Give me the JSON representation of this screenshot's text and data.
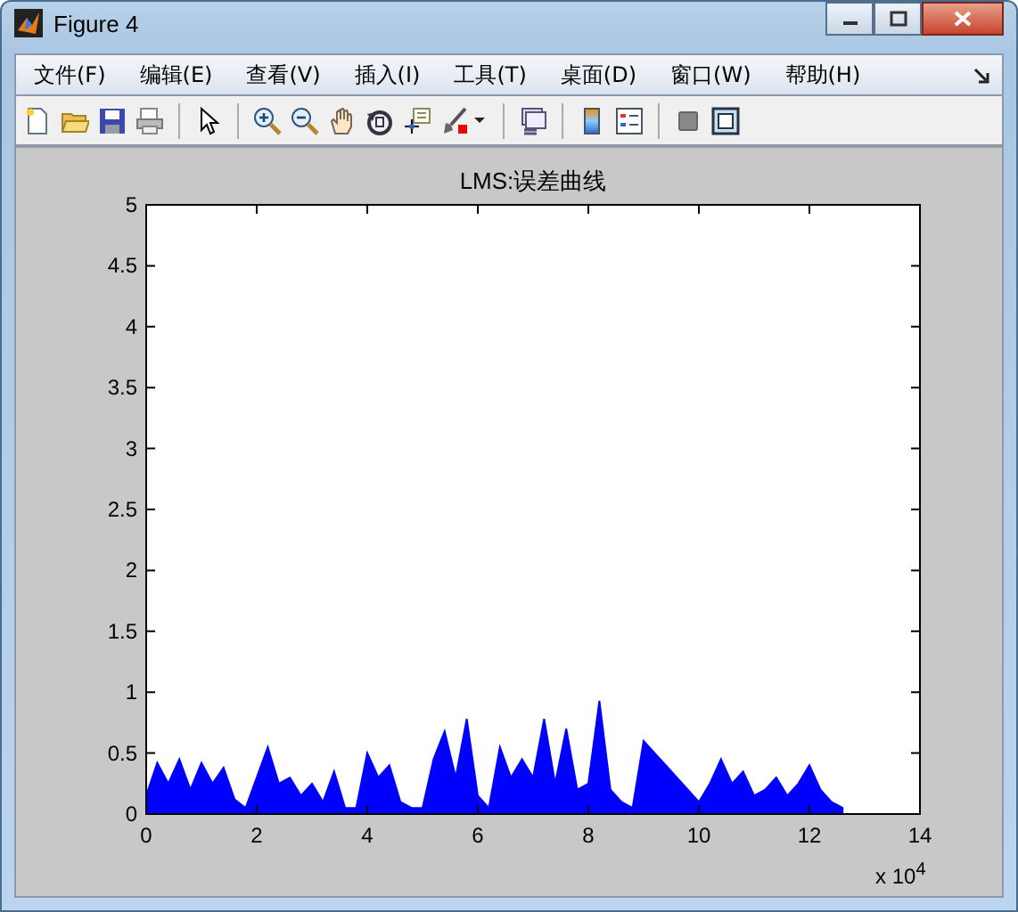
{
  "window": {
    "title": "Figure 4"
  },
  "menu": [
    "文件(F)",
    "编辑(E)",
    "查看(V)",
    "插入(I)",
    "工具(T)",
    "桌面(D)",
    "窗口(W)",
    "帮助(H)"
  ],
  "toolbar": [
    {
      "kind": "new"
    },
    {
      "kind": "open"
    },
    {
      "kind": "save"
    },
    {
      "kind": "print"
    },
    {
      "kind": "sep"
    },
    {
      "kind": "pointer"
    },
    {
      "kind": "sep"
    },
    {
      "kind": "zoomin"
    },
    {
      "kind": "zoomout"
    },
    {
      "kind": "pan"
    },
    {
      "kind": "rotate"
    },
    {
      "kind": "cursor"
    },
    {
      "kind": "brush"
    },
    {
      "kind": "caret"
    },
    {
      "kind": "sep"
    },
    {
      "kind": "link"
    },
    {
      "kind": "sep"
    },
    {
      "kind": "colorbar"
    },
    {
      "kind": "legend"
    },
    {
      "kind": "sep"
    },
    {
      "kind": "hide"
    },
    {
      "kind": "show"
    }
  ],
  "figure": {
    "chart_data": {
      "type": "area",
      "title": "LMS:误差曲线",
      "xlim": [
        0,
        14
      ],
      "ylim": [
        0,
        5
      ],
      "xticks": [
        0,
        2,
        4,
        6,
        8,
        10,
        12,
        14
      ],
      "yticks": [
        0,
        0.5,
        1,
        1.5,
        2,
        2.5,
        3,
        3.5,
        4,
        4.5,
        5
      ],
      "annotations": [
        {
          "text": "x 10$^{4}$"
        }
      ],
      "x": [
        0,
        0.2,
        0.4,
        0.6,
        0.8,
        1,
        1.2,
        1.4,
        1.6,
        1.8,
        2,
        2.2,
        2.4,
        2.6,
        2.8,
        3,
        3.2,
        3.4,
        3.6,
        3.8,
        4,
        4.2,
        4.4,
        4.6,
        4.8,
        5,
        5.2,
        5.4,
        5.6,
        5.8,
        6,
        6.2,
        6.4,
        6.6,
        6.8,
        7,
        7.2,
        7.4,
        7.6,
        7.8,
        8,
        8.2,
        8.4,
        8.6,
        8.8,
        9,
        9.2,
        9.4,
        9.6,
        9.8,
        10,
        10.2,
        10.4,
        10.6,
        10.8,
        11,
        11.2,
        11.4,
        11.6,
        11.8,
        12,
        12.2,
        12.4,
        12.6
      ],
      "series": [
        {
          "color": "#0000ff",
          "values": [
            0.15,
            0.42,
            0.25,
            0.45,
            0.2,
            0.42,
            0.25,
            0.38,
            0.12,
            0.05,
            0.3,
            0.55,
            0.25,
            0.3,
            0.15,
            0.25,
            0.1,
            0.35,
            0.05,
            0.05,
            0.5,
            0.3,
            0.4,
            0.1,
            0.05,
            0.05,
            0.45,
            0.68,
            0.3,
            0.78,
            0.15,
            0.05,
            0.55,
            0.3,
            0.45,
            0.3,
            0.78,
            0.25,
            0.7,
            0.2,
            0.25,
            0.93,
            0.2,
            0.1,
            0.05,
            0.6,
            0.5,
            0.4,
            0.3,
            0.2,
            0.1,
            0.25,
            0.45,
            0.25,
            0.35,
            0.15,
            0.2,
            0.3,
            0.15,
            0.25,
            0.4,
            0.2,
            0.1,
            0.05
          ]
        }
      ]
    }
  }
}
